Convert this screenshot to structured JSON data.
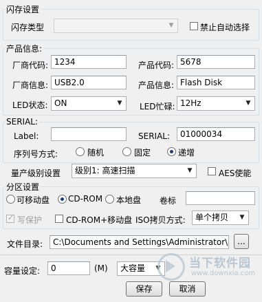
{
  "flash": {
    "group_title": "闪存设置",
    "type_label": "闪存类型",
    "type_value": "",
    "disable_autoselect_label": "禁止自动选择",
    "disable_autoselect_checked": false
  },
  "product": {
    "group_title": "产品信息:",
    "vendor_code_label": "厂商代码:",
    "vendor_code_value": "1234",
    "product_code_label": "产品代码:",
    "product_code_value": "5678",
    "vendor_info_label": "厂商信息:",
    "vendor_info_value": "USB2.0",
    "product_info_label": "产品信息:",
    "product_info_value": "Flash Disk",
    "led_state_label": "LED状态:",
    "led_state_value": "ON",
    "led_busy_label": "LED忙碌:",
    "led_busy_value": "12Hz"
  },
  "serial": {
    "group_title": "SERIAL:",
    "label_label": "Label:",
    "label_value": "",
    "serial_label": "SERIAL:",
    "serial_value": "01000034",
    "mode_label": "序列号方式:",
    "options": [
      "随机",
      "固定",
      "递增"
    ],
    "selected": "递增"
  },
  "production": {
    "level_label": "量产级别设置",
    "level_value": "级别1: 高速扫描",
    "aes_label": "AES使能",
    "aes_checked": false
  },
  "partition": {
    "group_title": "分区设置",
    "options": [
      "可移动盘",
      "CD-ROM",
      "本地盘"
    ],
    "selected": "CD-ROM",
    "volume_label": "卷标",
    "volume_value": "",
    "write_protect_label": "写保护",
    "write_protect_checked": true,
    "cdrom_removable_label": "CD-ROM+移动盘",
    "cdrom_removable_checked": false,
    "iso_label": "ISO拷贝方式:",
    "iso_value": "单个拷贝"
  },
  "file_dir": {
    "label": "文件目录:",
    "value": "C:\\Documents and Settings\\Administrator\\桌面\\黄金",
    "browse_label": "..."
  },
  "capacity": {
    "label": "容量设定:",
    "value": "0",
    "unit": "(M)",
    "mode_value": "大容量"
  },
  "buttons": {
    "save": "保存",
    "cancel": "取消"
  },
  "watermark": {
    "text": "当下软件园",
    "url": "www.downxia.com"
  },
  "colors": {
    "background": "#f0f0f0",
    "radio_dot": "#1a3a7a",
    "watermark": "#b9c7d2"
  }
}
